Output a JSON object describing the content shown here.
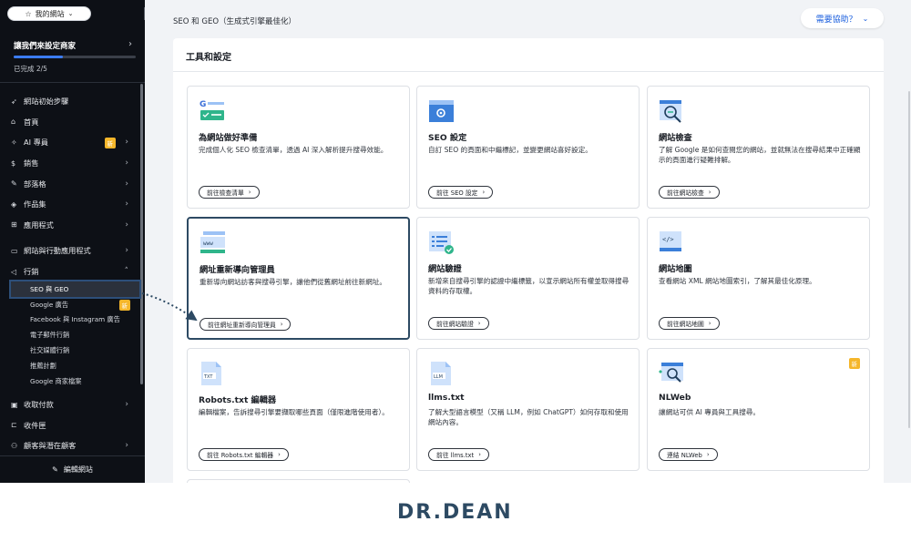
{
  "sidebar": {
    "site_selector": "我的網站",
    "setup": {
      "title": "讓我們來設定商家",
      "progress_text": "已完成 2/5",
      "progress_fraction": 0.4
    },
    "nav_items": [
      {
        "label": "網站初始步驟",
        "icon": "rocket-icon"
      },
      {
        "label": "首頁",
        "icon": "home-icon"
      },
      {
        "label": "AI 專員",
        "icon": "sparkle-icon",
        "badge": "新",
        "chevron": true
      },
      {
        "label": "銷售",
        "icon": "dollar-icon",
        "chevron": true
      },
      {
        "label": "部落格",
        "icon": "edit-icon",
        "chevron": true
      },
      {
        "label": "作品集",
        "icon": "portfolio-icon",
        "chevron": true
      },
      {
        "label": "應用程式",
        "icon": "apps-icon",
        "chevron": true
      }
    ],
    "nav_items_2": [
      {
        "label": "網站與行動應用程式",
        "icon": "devices-icon",
        "chevron": true
      },
      {
        "label": "行銷",
        "icon": "megaphone-icon",
        "chevron_up": true
      }
    ],
    "marketing_sub": [
      {
        "label": "SEO 與 GEO",
        "active": true
      },
      {
        "label": "Google 廣告",
        "badge": "新"
      },
      {
        "label": "Facebook 與 Instagram 廣告"
      },
      {
        "label": "電子郵件行銷"
      },
      {
        "label": "社交媒體行銷"
      },
      {
        "label": "推薦計劃"
      },
      {
        "label": "Google 商家檔案"
      }
    ],
    "nav_items_3": [
      {
        "label": "收取付款",
        "icon": "payment-icon",
        "chevron": true
      },
      {
        "label": "收件匣",
        "icon": "inbox-icon"
      },
      {
        "label": "顧客與潛在顧客",
        "icon": "customers-icon",
        "chevron": true
      }
    ],
    "edit_site": "編輯網站"
  },
  "header": {
    "title": "SEO 和 GEO（生成式引擎最佳化）",
    "help": "需要協助？"
  },
  "panel": {
    "title": "工具和設定",
    "cards": [
      {
        "title": "為網站做好準備",
        "desc": "完成個人化 SEO 檢查清單，透過 AI 深入解析提升搜尋效能。",
        "button": "前往檢查清單",
        "icon": "google-checklist-icon"
      },
      {
        "title": "SEO 設定",
        "desc": "自訂 SEO 的頁面和中繼標記，並變更網站喜好設定。",
        "button": "前往 SEO 設定",
        "icon": "settings-gear-icon"
      },
      {
        "title": "網站檢查",
        "desc": "了解 Google 是如何查閱您的網站，並就無法在搜尋結果中正確顯示的頁面進行疑難排解。",
        "button": "前往網站檢查",
        "icon": "magnifier-icon"
      },
      {
        "title": "網址重新導向管理員",
        "desc": "重新導向網站訪客與搜尋引擎，讓他們從舊網址前往新網址。",
        "button": "前往網址重新導向管理員",
        "icon": "redirect-icon"
      },
      {
        "title": "網站驗證",
        "desc": "新增來自搜尋引擎的認證中繼標籤，以宣示網站所有權並取得搜尋資料的存取權。",
        "button": "前往網站驗證",
        "icon": "verification-icon"
      },
      {
        "title": "網站地圖",
        "desc": "查看網站 XML 網站地圖索引，了解其最佳化原理。",
        "button": "前往網站地圖",
        "icon": "code-sitemap-icon"
      },
      {
        "title": "Robots.txt 編輯器",
        "desc": "編輯檔案，告訴搜尋引擎要擷取哪些頁面（僅限進階使用者）。",
        "button": "前往 Robots.txt 編輯器",
        "icon": "txt-file-icon"
      },
      {
        "title": "llms.txt",
        "desc": "了解大型語言模型（又稱 LLM，例如 ChatGPT）如何存取和使用網站內容。",
        "button": "前往 llms.txt",
        "icon": "llm-file-icon"
      },
      {
        "title": "NLWeb",
        "desc": "讓網站可供 AI 專員與工具搜尋。",
        "button": "連結 NLWeb",
        "icon": "nlweb-search-icon",
        "badge": "新"
      }
    ]
  },
  "logo": "DR.DEAN",
  "colors": {
    "sidebar_bg": "#0d1016",
    "accent_blue": "#1b5fde",
    "highlight": "#2d4a63",
    "new_badge": "#f5b62a"
  }
}
